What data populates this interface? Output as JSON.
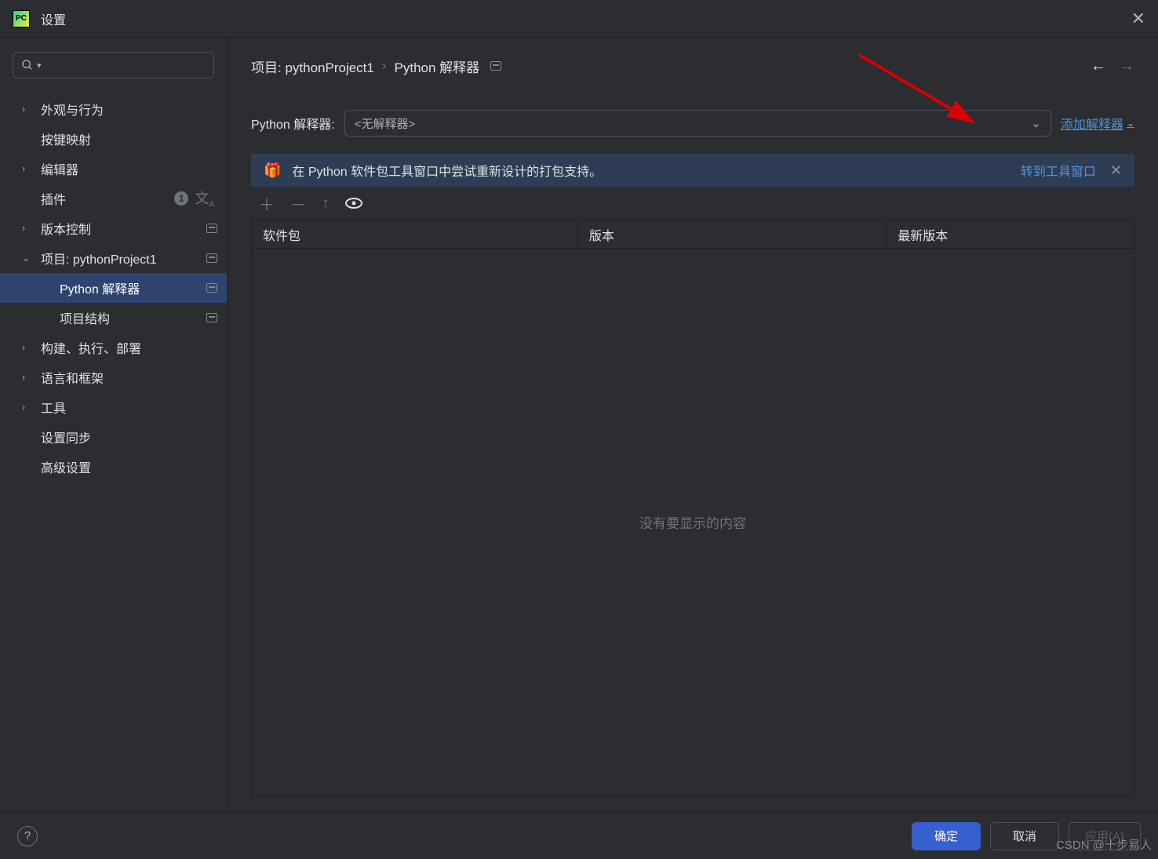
{
  "window": {
    "title": "设置"
  },
  "sidebar": {
    "items": [
      {
        "label": "外观与行为",
        "expandable": true
      },
      {
        "label": "按键映射",
        "expandable": false
      },
      {
        "label": "编辑器",
        "expandable": true
      },
      {
        "label": "插件",
        "expandable": false,
        "badge": "1",
        "langIcon": true
      },
      {
        "label": "版本控制",
        "expandable": true,
        "persist": true
      },
      {
        "label": "项目: pythonProject1",
        "expandable": true,
        "expanded": true,
        "persist": true,
        "children": [
          {
            "label": "Python 解释器",
            "persist": true,
            "selected": true
          },
          {
            "label": "项目结构",
            "persist": true
          }
        ]
      },
      {
        "label": "构建、执行、部署",
        "expandable": true
      },
      {
        "label": "语言和框架",
        "expandable": true
      },
      {
        "label": "工具",
        "expandable": true
      },
      {
        "label": "设置同步",
        "expandable": false
      },
      {
        "label": "高级设置",
        "expandable": false
      }
    ]
  },
  "breadcrumb": {
    "part1": "项目: pythonProject1",
    "part2": "Python 解释器"
  },
  "interpreter": {
    "label": "Python 解释器:",
    "value": "<无解释器>",
    "addLink": "添加解释器"
  },
  "banner": {
    "text": "在 Python 软件包工具窗口中尝试重新设计的打包支持。",
    "link": "转到工具窗口"
  },
  "packages": {
    "columns": {
      "name": "软件包",
      "version": "版本",
      "latest": "最新版本"
    },
    "empty": "没有要显示的内容"
  },
  "footer": {
    "ok": "确定",
    "cancel": "取消",
    "apply": "应用(A)"
  },
  "watermark": "CSDN @十步易人"
}
